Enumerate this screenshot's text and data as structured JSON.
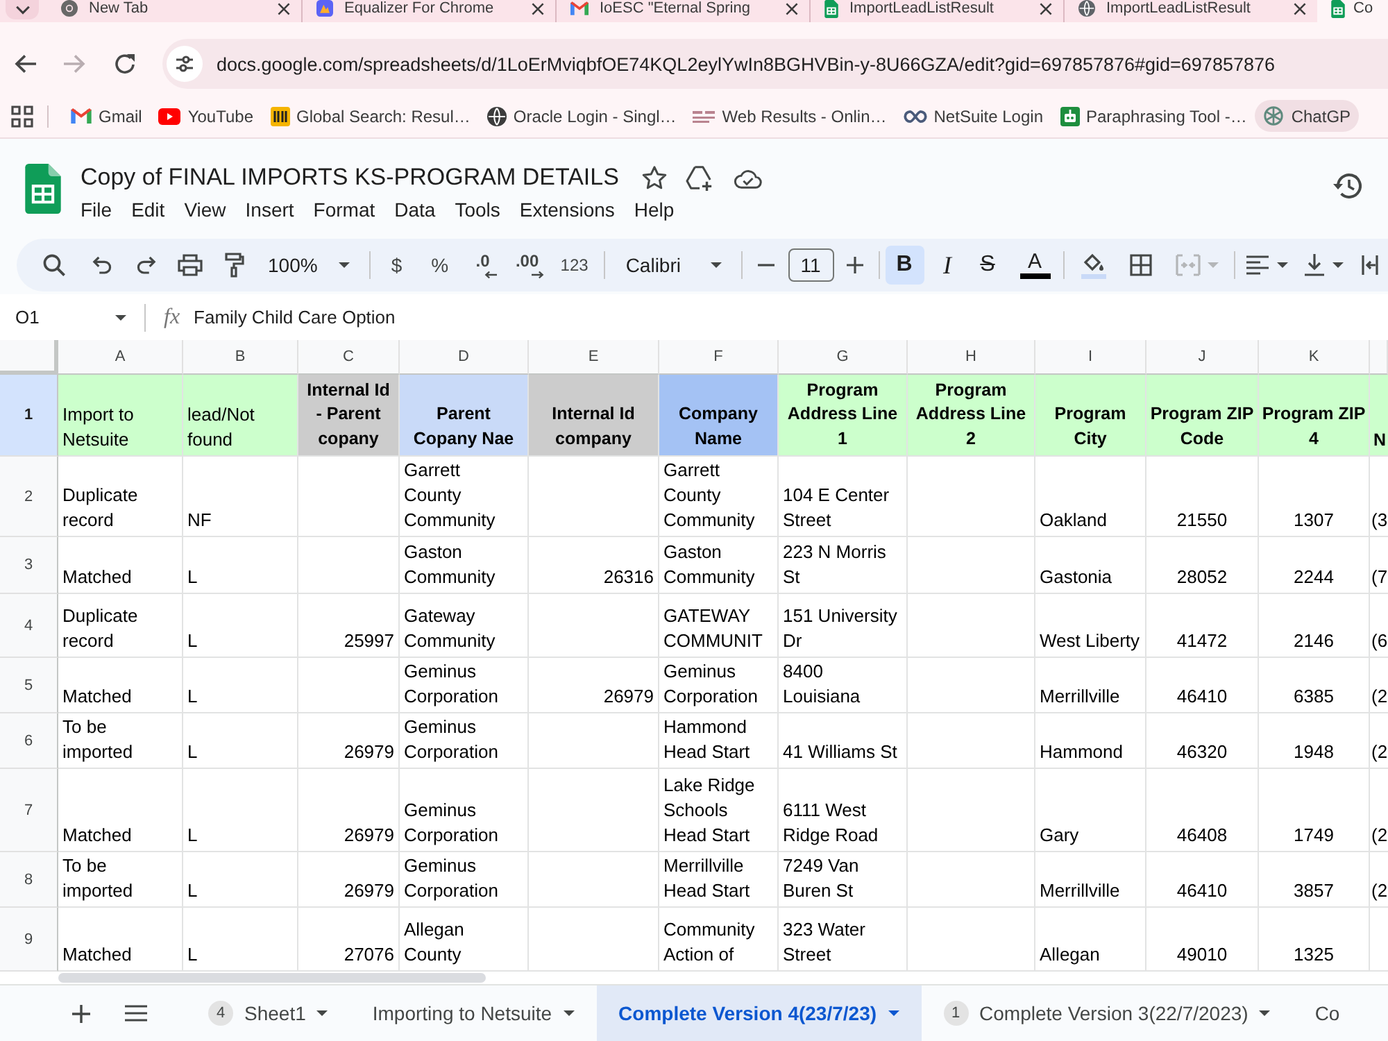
{
  "browser": {
    "tabs": [
      {
        "title": "New Tab",
        "kind": "newtab",
        "selected": false
      },
      {
        "title": "Equalizer For Chrome",
        "kind": "extension",
        "selected": false
      },
      {
        "title": "IoESC \"Eternal Spring",
        "kind": "mail",
        "selected": false
      },
      {
        "title": "ImportLeadListResult",
        "kind": "sheet",
        "selected": false
      },
      {
        "title": "ImportLeadListResult",
        "kind": "web",
        "selected": false
      },
      {
        "title": "Co",
        "kind": "sheet",
        "selected": true
      }
    ],
    "forward_disabled": true,
    "address": "docs.google.com/spreadsheets/d/1LoErMviqbfOE74KQL2eylYwIn8BGHVBin-y-8U66GZA/edit?gid=697857876#gid=697857876",
    "bookmarks": [
      {
        "label": "Gmail",
        "kind": "mail",
        "hovered": false
      },
      {
        "label": "YouTube",
        "kind": "video",
        "hovered": false
      },
      {
        "label": "Global Search: Resul…",
        "kind": "search",
        "hovered": false
      },
      {
        "label": "Oracle Login - Singl…",
        "kind": "web",
        "hovered": false
      },
      {
        "label": "Web Results - Onlin…",
        "kind": "results",
        "hovered": false
      },
      {
        "label": "NetSuite Login",
        "kind": "link",
        "hovered": false
      },
      {
        "label": "Paraphrasing Tool -…",
        "kind": "tool",
        "hovered": false
      },
      {
        "label": "ChatGP",
        "kind": "chat",
        "hovered": true
      }
    ]
  },
  "sheet": {
    "title": "Copy of FINAL IMPORTS KS-PROGRAM DETAILS",
    "menu": [
      "File",
      "Edit",
      "View",
      "Insert",
      "Format",
      "Data",
      "Tools",
      "Extensions",
      "Help"
    ]
  },
  "toolbar": {
    "zoom": "100%",
    "currency": "$",
    "percent": "%",
    "decrease_decimal": ".0",
    "increase_decimal": ".00",
    "number_format": "123",
    "font": "Calibri",
    "font_size": "11",
    "bold": {
      "label": "B",
      "on": true
    },
    "italic": {
      "label": "I",
      "on": false
    },
    "strikethrough": {
      "label": "S",
      "on": false
    },
    "text_color": "A",
    "merge_disabled": true
  },
  "formula_bar": {
    "cell": "O1",
    "fx": "fx",
    "value": "Family Child Care Option"
  },
  "grid": {
    "columns": [
      "A",
      "B",
      "C",
      "D",
      "E",
      "F",
      "G",
      "H",
      "I",
      "J",
      "K"
    ],
    "header_row": {
      "number": "1",
      "selected": true,
      "cells": [
        {
          "text": "Import to\nNetsuite",
          "kind": "plain",
          "color": "#ccffcc"
        },
        {
          "text": "lead/Not\nfound",
          "kind": "plain",
          "color": "#ccffcc"
        },
        {
          "text": "Internal Id\n- Parent\ncopany",
          "kind": "heading",
          "color": "#cccccc"
        },
        {
          "text": "Parent\nCopany Nae",
          "kind": "heading",
          "color": "#c9daf8"
        },
        {
          "text": "Internal Id\ncompany",
          "kind": "heading",
          "color": "#cccccc"
        },
        {
          "text": "Company\nName",
          "kind": "heading",
          "color": "#a4c2f4"
        },
        {
          "text": "Program\nAddress Line\n1",
          "kind": "heading",
          "color": "#ccffcc"
        },
        {
          "text": "Program\nAddress Line\n2",
          "kind": "heading",
          "color": "#ccffcc"
        },
        {
          "text": "Program\nCity",
          "kind": "heading",
          "color": "#ccffcc"
        },
        {
          "text": "Program ZIP\nCode",
          "kind": "heading",
          "color": "#ccffcc"
        },
        {
          "text": "Program ZIP\n4",
          "kind": "heading",
          "color": "#ccffcc"
        },
        {
          "text": "N",
          "kind": "heading",
          "color": "#ccffcc"
        }
      ]
    },
    "rows": [
      {
        "number": "2",
        "cells": [
          "Duplicate\nrecord",
          "NF",
          null,
          "Garrett\nCounty\nCommunity",
          null,
          "Garrett\nCounty\nCommunity",
          "104 E Center\nStreet",
          null,
          "Oakland",
          "21550",
          "1307",
          "(3"
        ]
      },
      {
        "number": "3",
        "cells": [
          "Matched",
          "L",
          null,
          "Gaston\nCommunity",
          "26316",
          "Gaston\nCommunity",
          "223 N Morris\nSt",
          null,
          "Gastonia",
          "28052",
          "2244",
          "(7"
        ]
      },
      {
        "number": "4",
        "cells": [
          "Duplicate\nrecord",
          "L",
          "25997",
          "Gateway\nCommunity",
          null,
          "GATEWAY\nCOMMUNIT",
          "151 University\nDr",
          null,
          "West Liberty",
          "41472",
          "2146",
          "(6"
        ]
      },
      {
        "number": "5",
        "cells": [
          "Matched",
          "L",
          null,
          "Geminus\nCorporation",
          "26979",
          "Geminus\nCorporation",
          "8400\nLouisiana",
          null,
          "Merrillville",
          "46410",
          "6385",
          "(2"
        ]
      },
      {
        "number": "6",
        "cells": [
          "To be\nimported",
          "L",
          "26979",
          "Geminus\nCorporation",
          null,
          "Hammond\nHead Start",
          "41 Williams St",
          null,
          "Hammond",
          "46320",
          "1948",
          "(2"
        ]
      },
      {
        "number": "7",
        "cells": [
          "Matched",
          "L",
          "26979",
          "Geminus\nCorporation",
          null,
          "Lake Ridge\nSchools\nHead Start",
          "6111 West\nRidge Road",
          null,
          "Gary",
          "46408",
          "1749",
          "(2"
        ]
      },
      {
        "number": "8",
        "cells": [
          "To be\nimported",
          "L",
          "26979",
          "Geminus\nCorporation",
          null,
          "Merrillville\nHead Start",
          "7249 Van\nBuren St",
          null,
          "Merrillville",
          "46410",
          "3857",
          "(2"
        ]
      },
      {
        "number": "9",
        "cells": [
          "Matched",
          "L",
          "27076",
          "Allegan\nCounty",
          null,
          "Community\nAction of",
          "323 Water\nStreet",
          null,
          "Allegan",
          "49010",
          "1325",
          null
        ]
      }
    ]
  },
  "sheet_tabs": [
    {
      "label": "Sheet1",
      "badge": "4",
      "selected": false
    },
    {
      "label": "Importing to Netsuite",
      "selected": false
    },
    {
      "label": "Complete Version 4(23/7/23)",
      "selected": true
    },
    {
      "label": "Complete Version 3(22/7/2023)",
      "badge": "1",
      "selected": false
    },
    {
      "label": "Co",
      "selected": false
    }
  ]
}
